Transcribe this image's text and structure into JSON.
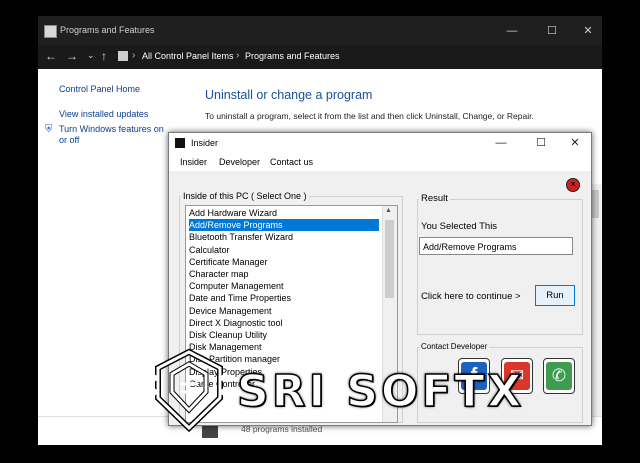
{
  "background_window": {
    "title": "Programs and Features",
    "buttons": {
      "minimize": "—",
      "maximize": "☐",
      "close": "✕"
    },
    "nav": {
      "back": "←",
      "forward": "→",
      "dropdown": "⌄",
      "up": "↑"
    },
    "breadcrumb": [
      "All Control Panel Items",
      "Programs and Features"
    ],
    "breadcrumb_sep": "›",
    "sidebar": {
      "home": "Control Panel Home",
      "updates": "View installed updates",
      "features": "Turn Windows features on or off"
    },
    "heading": "Uninstall or change a program",
    "description": "To uninstall a program, select it from the list and then click Uninstall, Change, or Repair.",
    "status": "48 programs installed"
  },
  "dialog": {
    "title": "Insider",
    "buttons": {
      "minimize": "—",
      "maximize": "☐",
      "close": "✕"
    },
    "menu": [
      "Insider",
      "Developer",
      "Contact us"
    ],
    "list_group_title": "Inside of this PC (  Select One )",
    "list_items": [
      "Add Hardware Wizard",
      "Add/Remove Programs",
      "Bluetooth Transfer Wizard",
      "Calculator",
      "Certificate Manager",
      "Character map",
      "Computer Management",
      "Date and Time Properties",
      "Device Management",
      "Direct X Diagnostic tool",
      "Disk Cleanup Utility",
      "Disk Management",
      "Disk Partition manager",
      "Display Properties",
      "Game Controller"
    ],
    "selected_index": 1,
    "result": {
      "title": "Result",
      "you_selected_label": "You Selected This",
      "selected_value": "Add/Remove Programs",
      "continue_label": "Click here to continue >",
      "run_label": "Run"
    },
    "contact": {
      "title": "Contact Developer"
    }
  },
  "watermark": {
    "text": "SRI SOFTX"
  },
  "colors": {
    "selection": "#0078d7",
    "link": "#0c3d91",
    "heading": "#1a4f9c"
  }
}
